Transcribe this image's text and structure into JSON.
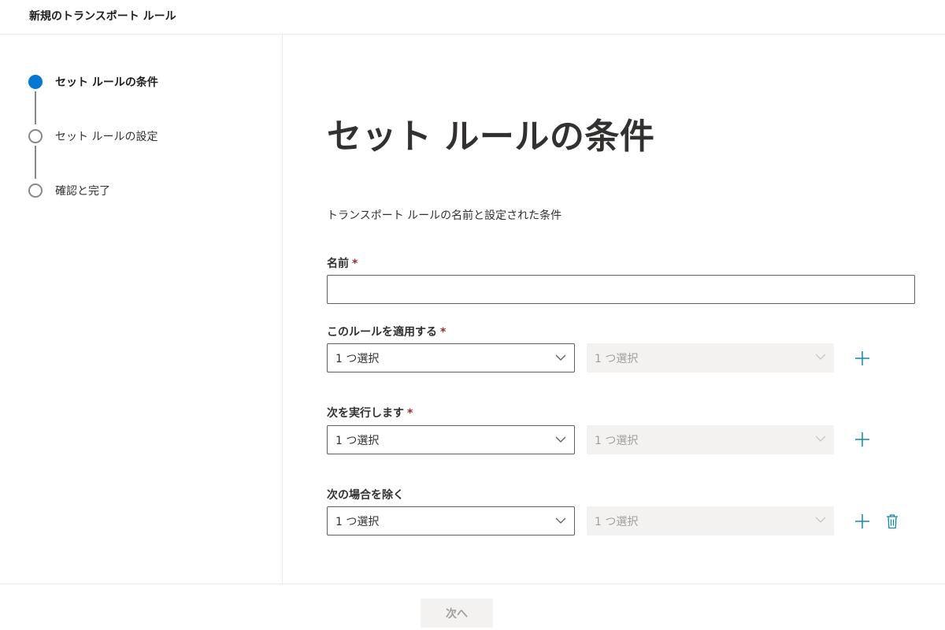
{
  "header": {
    "title": "新規のトランスポート ルール"
  },
  "steps": [
    {
      "label": "セット ルールの条件",
      "state": "active"
    },
    {
      "label": "セット ルールの設定",
      "state": "pending"
    },
    {
      "label": "確認と完了",
      "state": "pending"
    }
  ],
  "main": {
    "title": "セット ルールの条件",
    "description": "トランスポート ルールの名前と設定された条件",
    "name_field": {
      "label": "名前",
      "required": "*",
      "value": ""
    },
    "apply_rule": {
      "label": "このルールを適用する",
      "required": "*",
      "select1": "1 つ選択",
      "select2": "1 つ選択"
    },
    "do_following": {
      "label": "次を実行します",
      "required": "*",
      "select1": "1 つ選択",
      "select2": "1 つ選択"
    },
    "except_if": {
      "label": "次の場合を除く",
      "select1": "1 つ選択",
      "select2": "1 つ選択"
    }
  },
  "footer": {
    "next_label": "次へ"
  },
  "colors": {
    "accent": "#0078d4",
    "required": "#a4262c",
    "icon_teal": "#0f8ca8"
  },
  "icons": {
    "add": "plus-icon",
    "delete": "trash-icon",
    "dropdown": "chevron-down-icon"
  }
}
